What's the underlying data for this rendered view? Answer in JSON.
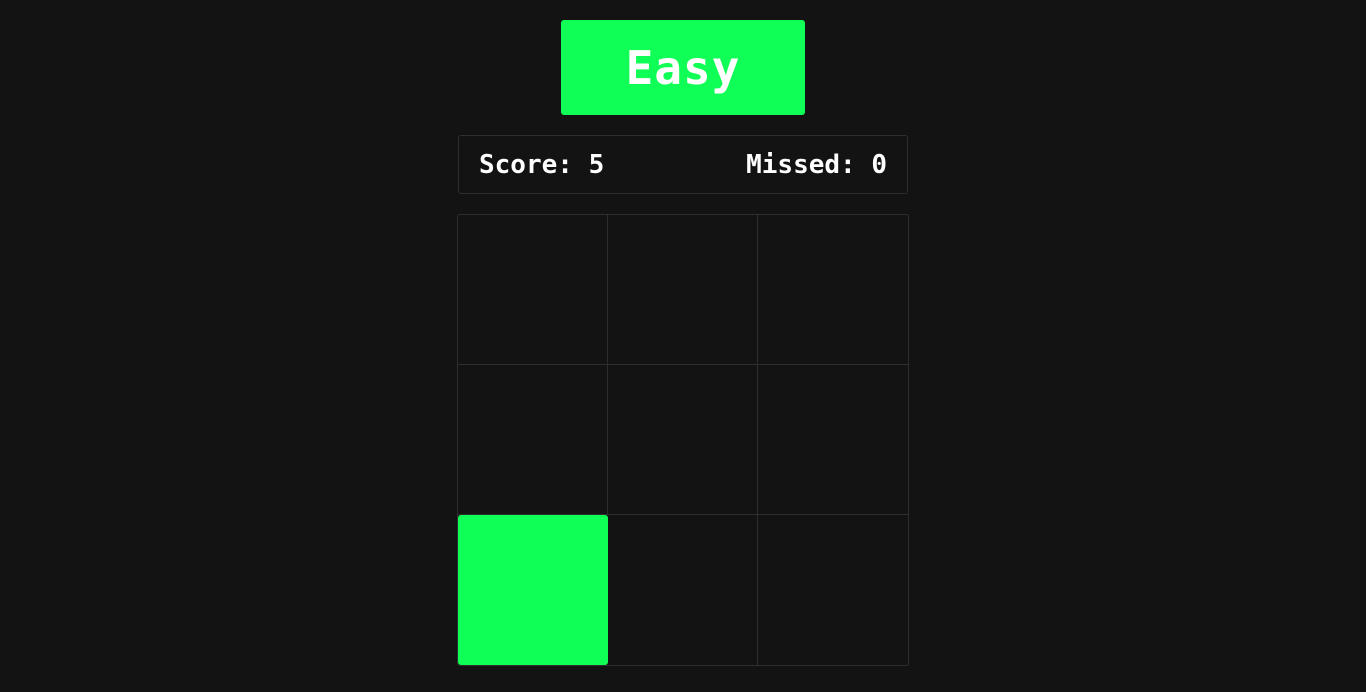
{
  "colors": {
    "background": "#131313",
    "accent": "#10ff57",
    "text": "#ffffff",
    "border": "#2e2e2e"
  },
  "difficulty": {
    "label": "Easy"
  },
  "scoreboard": {
    "score_text": "Score: 5",
    "missed_text": "Missed: 0",
    "score": 5,
    "missed": 0
  },
  "grid": {
    "rows": 3,
    "cols": 3,
    "active_cell_index": 6
  }
}
